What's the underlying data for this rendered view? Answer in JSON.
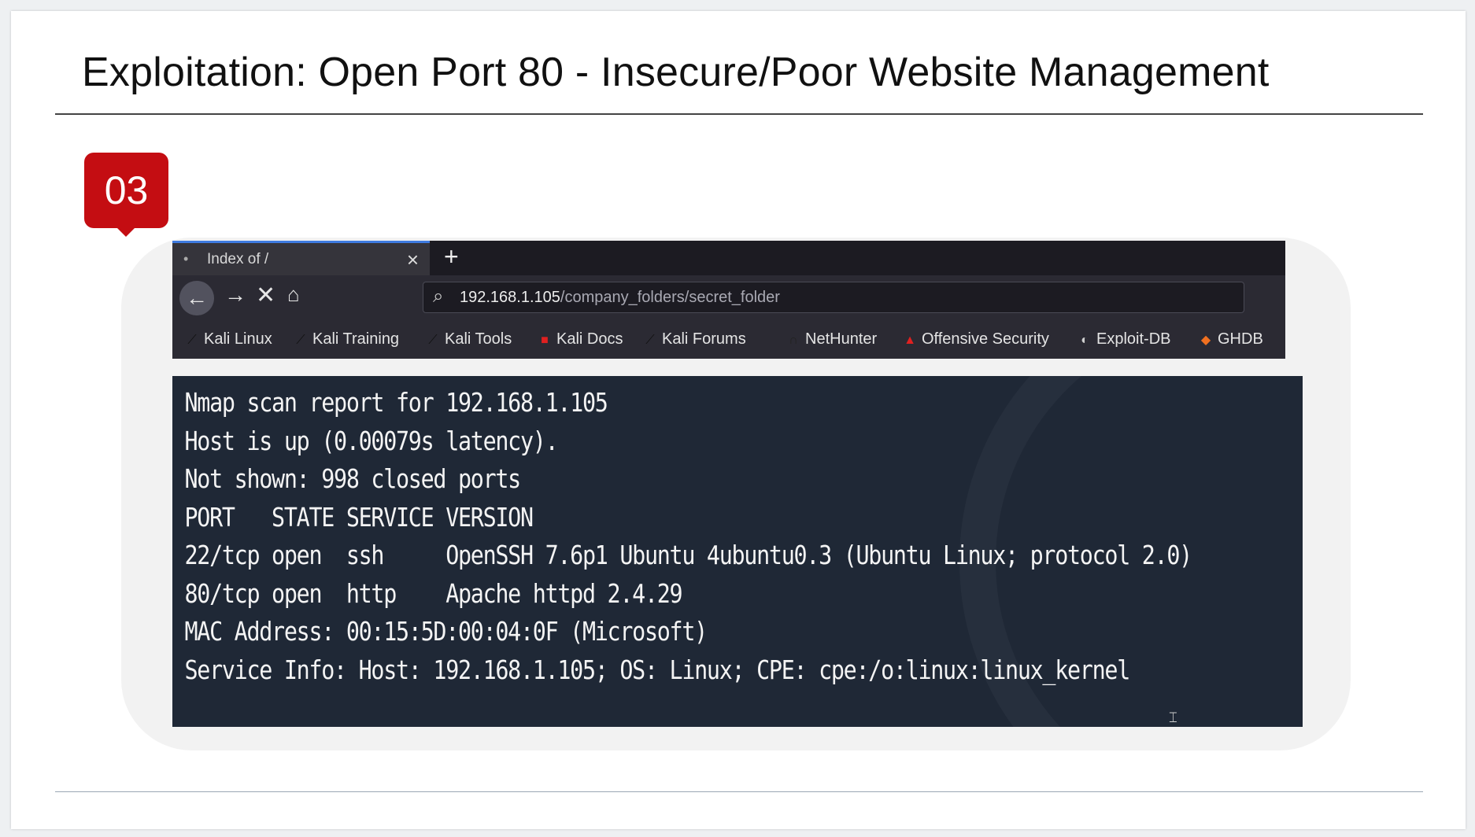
{
  "slide": {
    "title": "Exploitation: Open Port 80 - Insecure/Poor Website Management",
    "step_number": "03"
  },
  "browser": {
    "tab_title": "Index of /",
    "tab_close_icon": "close-icon",
    "new_tab_icon": "plus-icon",
    "nav_icons": [
      "back-arrow-icon",
      "forward-arrow-icon",
      "stop-icon",
      "home-icon"
    ],
    "url_host": "192.168.1.105",
    "url_path": "/company_folders/secret_folder",
    "bookmarks": [
      {
        "label": "Kali Linux",
        "icon": "kali-dragon-icon"
      },
      {
        "label": "Kali Training",
        "icon": "kali-dragon-icon"
      },
      {
        "label": "Kali Tools",
        "icon": "kali-dragon-icon"
      },
      {
        "label": "Kali Docs",
        "icon": "kali-docs-icon"
      },
      {
        "label": "Kali Forums",
        "icon": "kali-dragon-icon"
      },
      {
        "label": "NetHunter",
        "icon": "nethunter-icon"
      },
      {
        "label": "Offensive Security",
        "icon": "offsec-icon"
      },
      {
        "label": "Exploit-DB",
        "icon": "exploitdb-icon"
      },
      {
        "label": "GHDB",
        "icon": "ghdb-icon"
      }
    ]
  },
  "terminal": {
    "lines": [
      "Nmap scan report for 192.168.1.105",
      "Host is up (0.00079s latency).",
      "Not shown: 998 closed ports",
      "PORT   STATE SERVICE VERSION",
      "22/tcp open  ssh     OpenSSH 7.6p1 Ubuntu 4ubuntu0.3 (Ubuntu Linux; protocol 2.0)",
      "80/tcp open  http    Apache httpd 2.4.29",
      "MAC Address: 00:15:5D:00:04:0F (Microsoft)",
      "Service Info: Host: 192.168.1.105; OS: Linux; CPE: cpe:/o:linux:linux_kernel"
    ]
  },
  "colors": {
    "accent_red": "#c40d12",
    "terminal_bg": "#1f2836",
    "browser_chrome": "#2b2a33"
  }
}
